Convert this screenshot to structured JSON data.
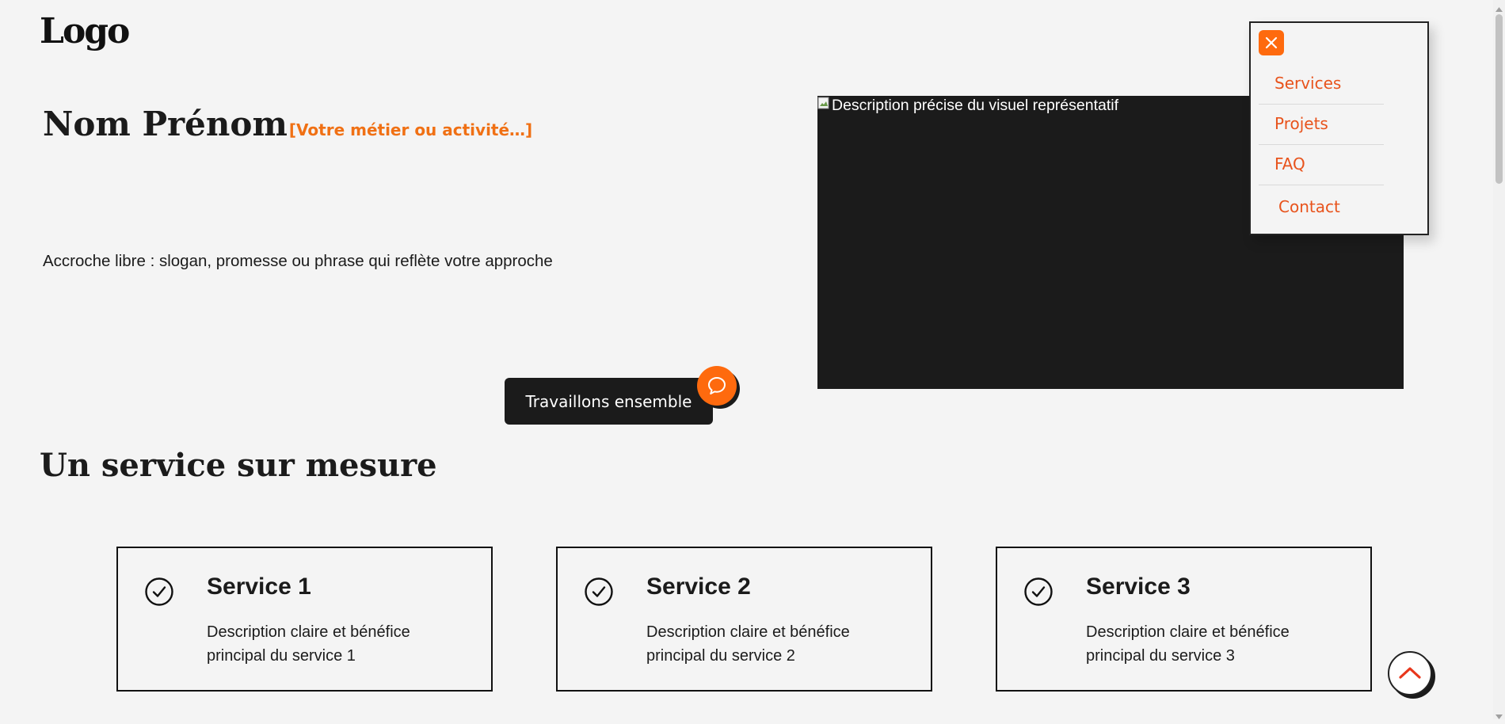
{
  "header": {
    "logo": "Logo"
  },
  "hero": {
    "name": "Nom Prénom",
    "job": "[Votre métier ou activité…]",
    "tagline": "Accroche libre : slogan, promesse ou phrase qui reflète votre approche",
    "cta_label": "Travaillons ensemble",
    "image_alt": "Description précise du visuel représentatif"
  },
  "nav": {
    "items": [
      "Services",
      "Projets",
      "FAQ",
      "Contact"
    ]
  },
  "services": {
    "title": "Un service sur mesure",
    "items": [
      {
        "title": "Service 1",
        "desc": "Description claire et bénéfice principal du service 1"
      },
      {
        "title": "Service 2",
        "desc": "Description claire et bénéfice principal du service 2"
      },
      {
        "title": "Service 3",
        "desc": "Description claire et bénéfice principal du service 3"
      }
    ]
  },
  "colors": {
    "accent": "#fe6a0e",
    "dark": "#1b1b1b",
    "background": "#f4f4f4"
  },
  "icons": [
    "close-icon",
    "chat-bubble-icon",
    "check-circle-icon",
    "chevron-up-icon",
    "broken-image-icon"
  ]
}
